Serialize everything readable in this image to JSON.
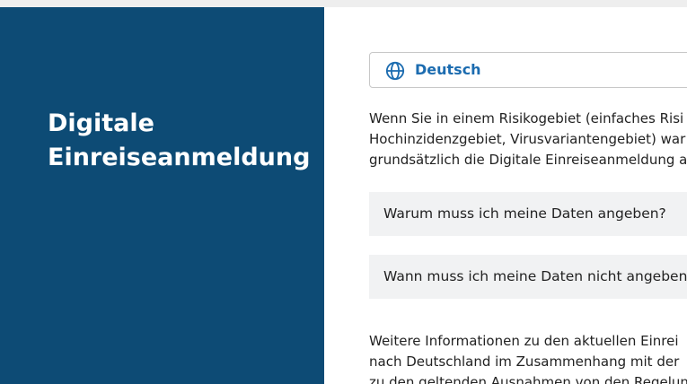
{
  "hero": {
    "title_line1": "Digitale",
    "title_line2": "Einreiseanmeldung"
  },
  "language": {
    "icon": "globe-icon",
    "label": "Deutsch"
  },
  "intro": {
    "line1": "Wenn Sie in einem Risikogebiet (einfaches Risi",
    "line2": "Hochinzidenzgebiet, Virusvariantengebiet) war",
    "line3": "grundsätzlich die Digitale Einreiseanmeldung a"
  },
  "faq": [
    {
      "label": "Warum muss ich meine Daten angeben?"
    },
    {
      "label": "Wann muss ich meine Daten nicht angeben?"
    }
  ],
  "more": {
    "line1": "Weitere Informationen zu den aktuellen Einrei",
    "line2": "nach Deutschland im Zusammenhang mit der",
    "line3": "zu den geltenden Ausnahmen von den Regelun"
  },
  "colors": {
    "hero_bg": "#0d4b75",
    "accent": "#1c6cb0",
    "faq_bg": "#f1f2f3"
  }
}
